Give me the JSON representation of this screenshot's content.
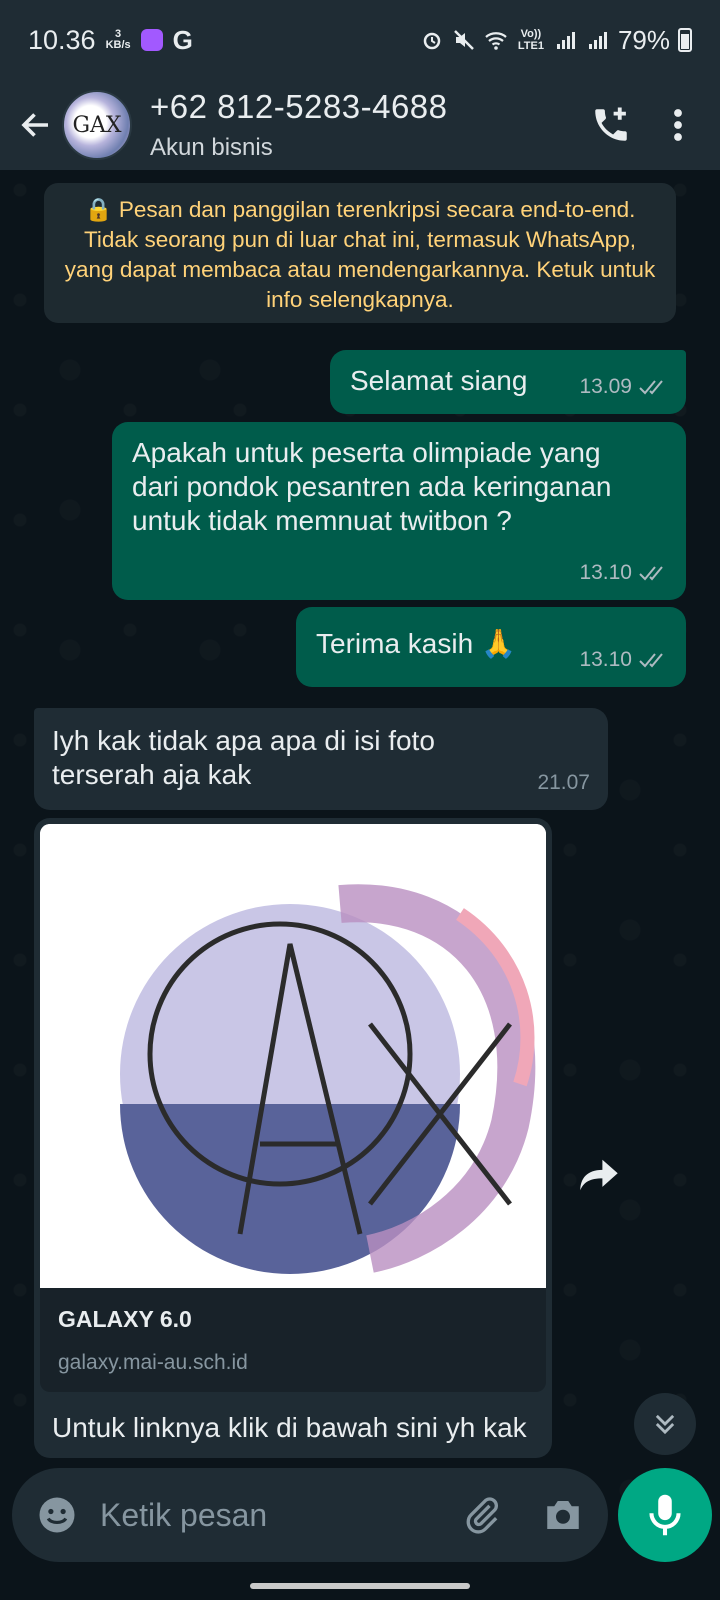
{
  "status_bar": {
    "time": "10.36",
    "net_speed": "3",
    "net_unit": "KB/s",
    "g_label": "G",
    "lte_label": "Vo)) LTE1",
    "battery": "79%"
  },
  "header": {
    "contact": "+62 812-5283-4688",
    "subtitle": "Akun bisnis",
    "avatar_text": "GAX"
  },
  "encryption_notice": "🔒 Pesan dan panggilan terenkripsi secara end-to-end. Tidak seorang pun di luar chat ini, termasuk WhatsApp, yang dapat membaca atau mendengarkannya. Ketuk untuk info selengkapnya.",
  "messages": [
    {
      "dir": "out",
      "text": "Selamat siang",
      "time": "13.09"
    },
    {
      "dir": "out",
      "text": "Apakah untuk peserta olimpiade yang dari pondok pesantren ada keringanan untuk tidak memnuat twitbon ?",
      "time": "13.10"
    },
    {
      "dir": "out",
      "text": "Terima kasih 🙏",
      "time": "13.10"
    },
    {
      "dir": "in",
      "text": "Iyh kak tidak apa apa di isi foto terserah aja kak",
      "time": "21.07"
    }
  ],
  "link_preview": {
    "title": "GALAXY 6.0",
    "url": "galaxy.mai-au.sch.id",
    "logo_text": "GAX",
    "body": "Untuk linknya klik di bawah sini yh kak"
  },
  "composer": {
    "placeholder": "Ketik pesan"
  },
  "colors": {
    "outgoing_bubble": "#005c4b",
    "incoming_bubble": "#1f2c34",
    "accent": "#00a884",
    "notice_text": "#ffd279"
  }
}
